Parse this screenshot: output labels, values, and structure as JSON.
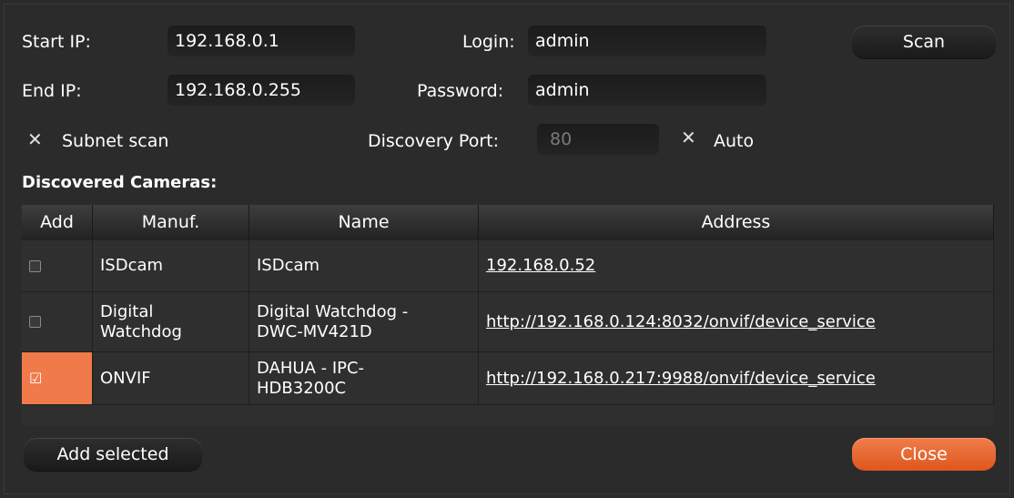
{
  "form": {
    "start_ip_label": "Start IP:",
    "start_ip_value": "192.168.0.1",
    "end_ip_label": "End IP:",
    "end_ip_value": "192.168.0.255",
    "login_label": "Login:",
    "login_value": "admin",
    "password_label": "Password:",
    "password_value": "admin",
    "subnet_scan_label": "Subnet scan",
    "discovery_port_label": "Discovery Port:",
    "discovery_port_value": "80",
    "auto_label": "Auto",
    "scan_button": "Scan"
  },
  "section_title": "Discovered Cameras:",
  "table": {
    "columns": [
      "Add",
      "Manuf.",
      "Name",
      "Address"
    ],
    "rows": [
      {
        "checked": false,
        "manuf": "ISDcam",
        "name": "ISDcam",
        "address": "192.168.0.52"
      },
      {
        "checked": false,
        "manuf": "Digital Watchdog",
        "name": "Digital Watchdog - DWC-MV421D",
        "address": "http://192.168.0.124:8032/onvif/device_service"
      },
      {
        "checked": true,
        "manuf": "ONVIF",
        "name": "DAHUA - IPC-HDB3200C",
        "address": "http://192.168.0.217:9988/onvif/device_service"
      }
    ]
  },
  "footer": {
    "add_selected_button": "Add selected",
    "close_button": "Close"
  },
  "colors": {
    "background": "#2b2b2b",
    "accent": "#f07a4a"
  }
}
